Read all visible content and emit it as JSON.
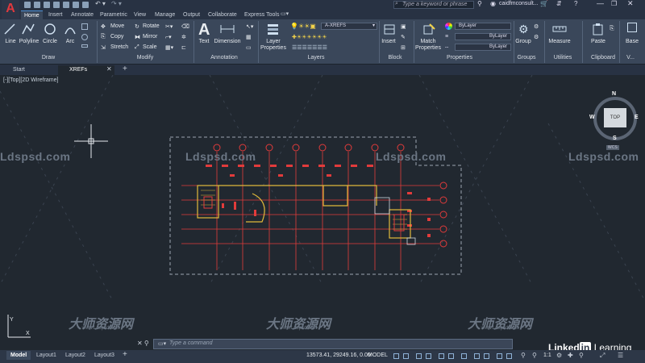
{
  "titlebar": {
    "search_placeholder": "Type a keyword or phrase",
    "user": "caidfmconsult..."
  },
  "ribbon_tabs": [
    "Home",
    "Insert",
    "Annotate",
    "Parametric",
    "View",
    "Manage",
    "Output",
    "Collaborate",
    "Express Tools"
  ],
  "ribbon": {
    "draw": {
      "label": "Draw",
      "tools": [
        "Line",
        "Polyline",
        "Circle",
        "Arc"
      ]
    },
    "modify": {
      "label": "Modify",
      "tools": [
        "Move",
        "Rotate",
        "Copy",
        "Mirror",
        "Stretch",
        "Scale"
      ]
    },
    "annotation": {
      "label": "Annotation",
      "tools": [
        "Text",
        "Dimension"
      ]
    },
    "layers": {
      "label": "Layers",
      "layer_properties": "Layer Properties",
      "current_layer": "A-XREFS"
    },
    "block": {
      "label": "Block",
      "insert": "Insert"
    },
    "properties": {
      "label": "Properties",
      "match": "Match Properties",
      "bylayer": [
        "ByLayer",
        "ByLayer",
        "ByLayer"
      ]
    },
    "groups": {
      "label": "Groups",
      "group": "Group"
    },
    "utilities": {
      "label": "Utilities",
      "measure": "Measure"
    },
    "clipboard": {
      "label": "Clipboard",
      "paste": "Paste"
    },
    "view": {
      "label": "V...",
      "base": "Base"
    }
  },
  "file_tabs": [
    "Start",
    "XREFs"
  ],
  "viewport_label": "[-][Top][2D Wireframe]",
  "viewcube": {
    "top": "TOP",
    "n": "N",
    "s": "S",
    "e": "E",
    "w": "W",
    "wcs": "WCS"
  },
  "watermarks": {
    "site": "Ldspsd.com",
    "cn": "大师资源网",
    "sub": "www.Ldspsd.com"
  },
  "command": {
    "placeholder": "Type a command"
  },
  "layout_tabs": [
    "Model",
    "Layout1",
    "Layout2",
    "Layout3"
  ],
  "status": {
    "coords": "13573.41, 29249.16, 0.00",
    "model": "MODEL",
    "scale": "1:1"
  },
  "branding": {
    "linkedin": "Linked",
    "in": "in",
    "learning": "Learning"
  }
}
